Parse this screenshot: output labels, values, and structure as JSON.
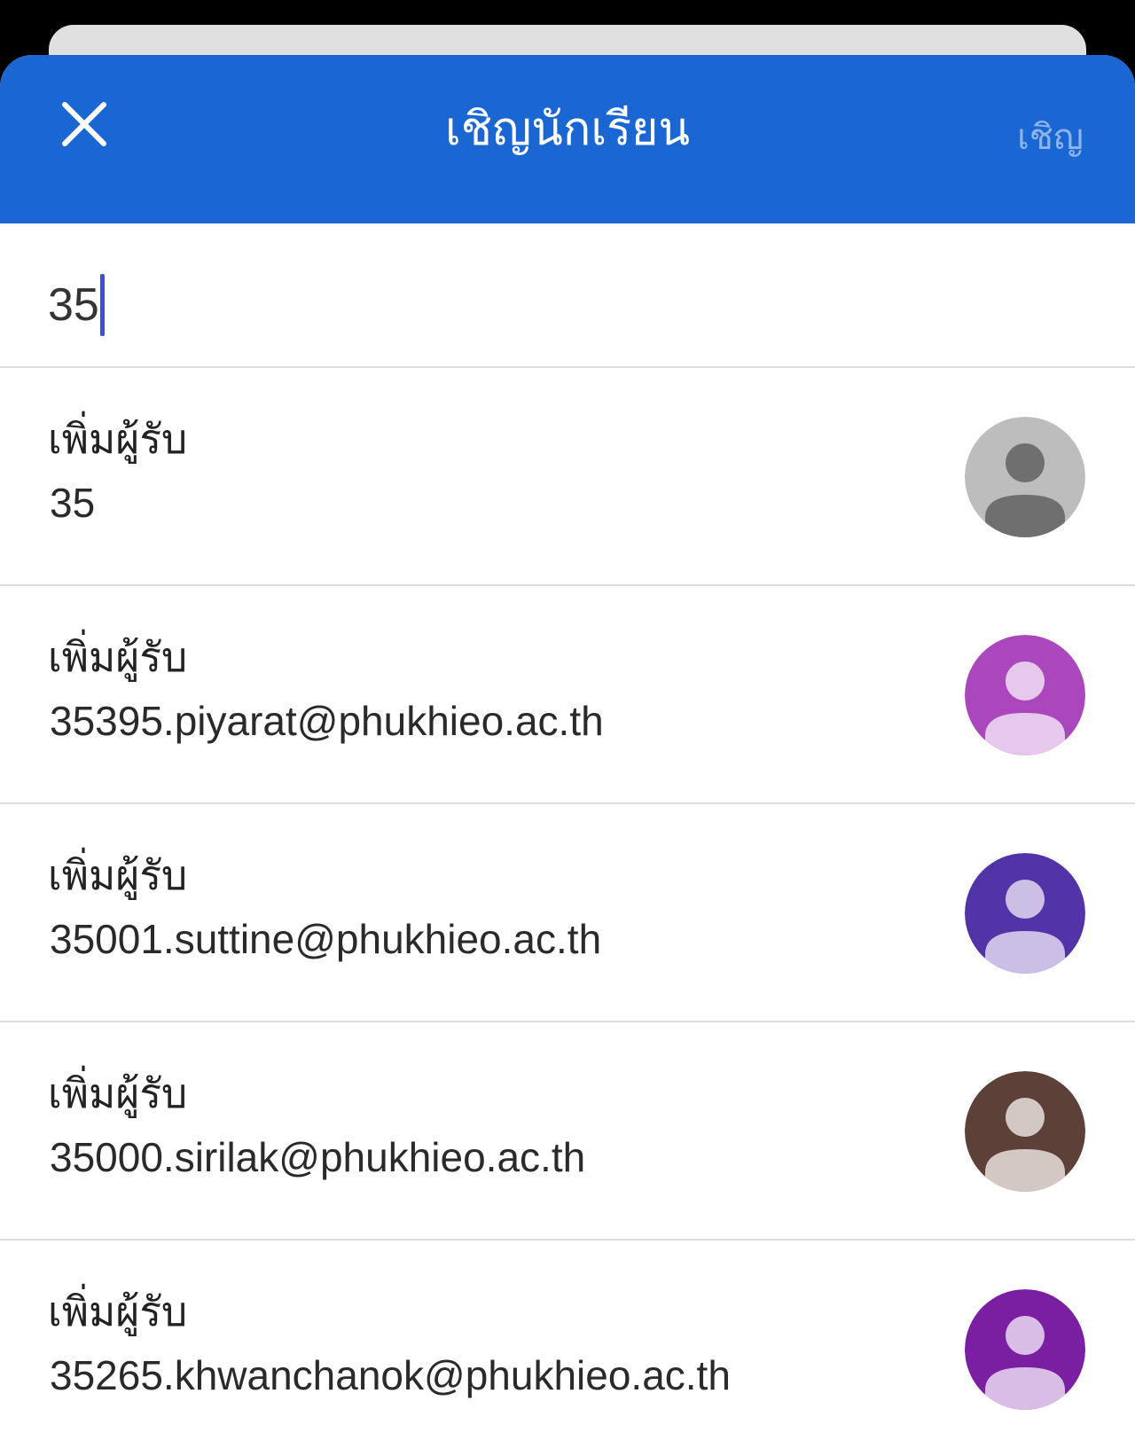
{
  "header": {
    "title": "เชิญนักเรียน",
    "close_icon": "close-icon",
    "invite_label": "เชิญ"
  },
  "search": {
    "value": "35"
  },
  "colors": {
    "header_bg": "#1a67d4",
    "invite_disabled": "#8fb4ea",
    "caret": "#3b4fd8"
  },
  "results": [
    {
      "title": "เพิ่มผู้รับ",
      "subtitle": "35",
      "avatar_icon": "person-icon",
      "avatar_bg": "#bdbdbd",
      "avatar_fg": "#6f6f6f"
    },
    {
      "title": "เพิ่มผู้รับ",
      "subtitle": "35395.piyarat@phukhieo.ac.th",
      "avatar_icon": "person-icon",
      "avatar_bg": "#ab47bc",
      "avatar_fg": "#e6c8ec"
    },
    {
      "title": "เพิ่มผู้รับ",
      "subtitle": "35001.suttine@phukhieo.ac.th",
      "avatar_icon": "person-icon",
      "avatar_bg": "#5234a8",
      "avatar_fg": "#cbbfe6"
    },
    {
      "title": "เพิ่มผู้รับ",
      "subtitle": "35000.sirilak@phukhieo.ac.th",
      "avatar_icon": "person-icon",
      "avatar_bg": "#5d4037",
      "avatar_fg": "#d3c8c4"
    },
    {
      "title": "เพิ่มผู้รับ",
      "subtitle": "35265.khwanchanok@phukhieo.ac.th",
      "avatar_icon": "person-icon",
      "avatar_bg": "#7b1fa2",
      "avatar_fg": "#d9bde6"
    }
  ]
}
